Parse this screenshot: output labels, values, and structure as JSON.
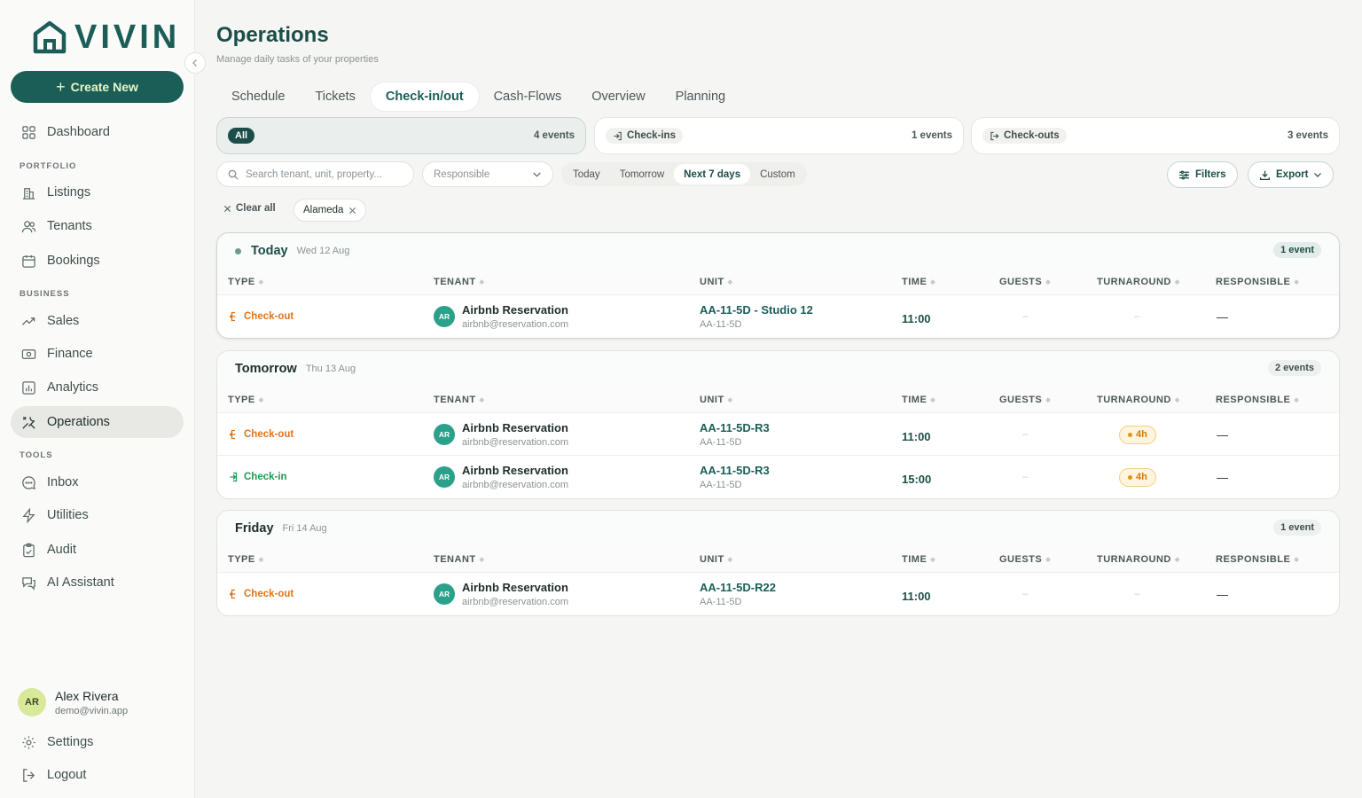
{
  "app": {
    "brand": "VIVIN"
  },
  "sidebar": {
    "create_label": "Create New",
    "dashboard": "Dashboard",
    "sections": {
      "portfolio": "PORTFOLIO",
      "business": "BUSINESS",
      "tools": "TOOLS"
    },
    "items": {
      "listings": "Listings",
      "tenants": "Tenants",
      "bookings": "Bookings",
      "sales": "Sales",
      "finance": "Finance",
      "analytics": "Analytics",
      "operations": "Operations",
      "inbox": "Inbox",
      "utilities": "Utilities",
      "audit": "Audit",
      "ai_assistant": "AI Assistant"
    },
    "user": {
      "initials": "AR",
      "name": "Alex Rivera",
      "email": "demo@vivin.app"
    },
    "settings": "Settings",
    "logout": "Logout"
  },
  "header": {
    "title": "Operations",
    "subtitle": "Manage daily tasks of your properties"
  },
  "tabs": [
    "Schedule",
    "Tickets",
    "Check-in/out",
    "Cash-Flows",
    "Overview",
    "Planning"
  ],
  "active_tab": "Check-in/out",
  "summary": {
    "all": {
      "label": "All",
      "count": "4 events"
    },
    "checkins": {
      "label": "Check-ins",
      "count": "1 events"
    },
    "checkouts": {
      "label": "Check-outs",
      "count": "3 events"
    }
  },
  "filters": {
    "search_placeholder": "Search tenant, unit, property...",
    "responsible_placeholder": "Responsible",
    "ranges": [
      "Today",
      "Tomorrow",
      "Next 7 days",
      "Custom"
    ],
    "active_range": "Next 7 days",
    "filters_label": "Filters",
    "export_label": "Export",
    "clear_all": "Clear all",
    "active_tag": "Alameda"
  },
  "columns": {
    "type": "TYPE",
    "tenant": "TENANT",
    "unit": "UNIT",
    "time": "TIME",
    "guests": "GUESTS",
    "turnaround": "TURNAROUND",
    "responsible": "RESPONSIBLE"
  },
  "groups": [
    {
      "title": "Today",
      "date": "Wed 12 Aug",
      "badge": "1 event",
      "rows": [
        {
          "type": "Check-out",
          "kind": "out",
          "tenant_initials": "AR",
          "tenant": "Airbnb Reservation",
          "email": "airbnb@reservation.com",
          "unit": "AA-11-5D - Studio 12",
          "unit_sub": "AA-11-5D",
          "time": "11:00",
          "guests": "–",
          "turnaround": "–",
          "responsible": "—"
        }
      ]
    },
    {
      "title": "Tomorrow",
      "date": "Thu 13 Aug",
      "badge": "2 events",
      "rows": [
        {
          "type": "Check-out",
          "kind": "out",
          "tenant_initials": "AR",
          "tenant": "Airbnb Reservation",
          "email": "airbnb@reservation.com",
          "unit": "AA-11-5D-R3",
          "unit_sub": "AA-11-5D",
          "time": "11:00",
          "guests": "–",
          "turnaround": "4h",
          "responsible": "—"
        },
        {
          "type": "Check-in",
          "kind": "in",
          "tenant_initials": "AR",
          "tenant": "Airbnb Reservation",
          "email": "airbnb@reservation.com",
          "unit": "AA-11-5D-R3",
          "unit_sub": "AA-11-5D",
          "time": "15:00",
          "guests": "–",
          "turnaround": "4h",
          "responsible": "—"
        }
      ]
    },
    {
      "title": "Friday",
      "date": "Fri 14 Aug",
      "badge": "1 event",
      "rows": [
        {
          "type": "Check-out",
          "kind": "out",
          "tenant_initials": "AR",
          "tenant": "Airbnb Reservation",
          "email": "airbnb@reservation.com",
          "unit": "AA-11-5D-R22",
          "unit_sub": "AA-11-5D",
          "time": "11:00",
          "guests": "–",
          "turnaround": "–",
          "responsible": "—"
        }
      ]
    }
  ],
  "colors": {
    "brand": "#1b5e57",
    "checkout": "#e07418",
    "checkin": "#1f9a52",
    "turnaround": "#d17a0a"
  }
}
